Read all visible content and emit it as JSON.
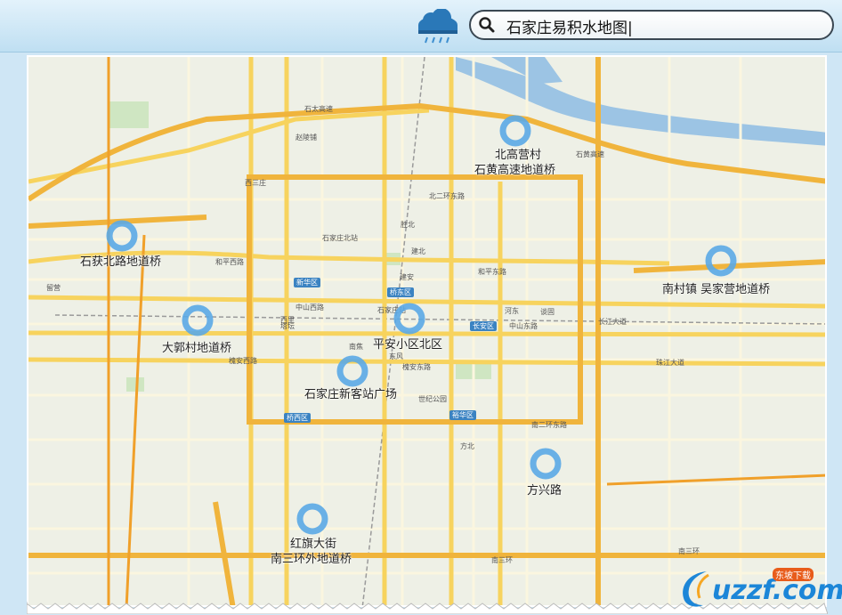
{
  "search": {
    "query": "石家庄易积水地图|"
  },
  "flood_points": [
    {
      "name": "北高营村",
      "sub": "石黄高速地道桥"
    },
    {
      "name": "石获北路地道桥",
      "sub": ""
    },
    {
      "name": "南村镇 吴家营地道桥",
      "sub": ""
    },
    {
      "name": "大郭村地道桥",
      "sub": ""
    },
    {
      "name": "平安小区北区",
      "sub": ""
    },
    {
      "name": "石家庄新客站广场",
      "sub": ""
    },
    {
      "name": "方兴路",
      "sub": ""
    },
    {
      "name": "红旗大街",
      "sub": "南三环外地道桥"
    }
  ],
  "districts": [
    "新华区",
    "桥东区",
    "长安区",
    "桥西区",
    "裕华区"
  ],
  "road_labels": [
    "和平西路",
    "中山西路",
    "槐安西路",
    "北二环东路",
    "和平东路",
    "中山东路",
    "槐安东路",
    "南二环东路",
    "南三环",
    "石太高速",
    "石黄高速",
    "长江大道",
    "珠江大道",
    "石家庄北站",
    "石家庄站",
    "胜北",
    "建北",
    "建安",
    "河东",
    "谈固",
    "塔坛",
    "南焦",
    "东风",
    "世纪公园",
    "方北",
    "赵陵铺",
    "西三庄",
    "西里",
    "留营",
    "南三环"
  ],
  "logo": {
    "text": "uzzf.com",
    "tag": "东坡下载"
  },
  "colors": {
    "water": "#9cc4e4",
    "ring": "#5aa9e6",
    "highway": "#f0b43c",
    "district_badge": "#3b83c2"
  }
}
